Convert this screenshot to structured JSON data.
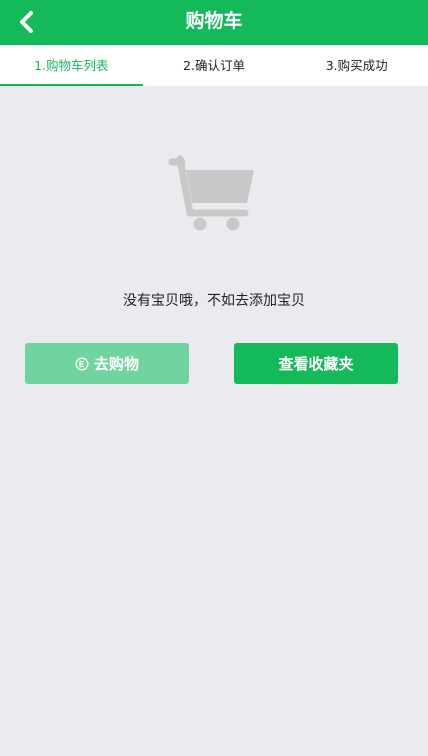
{
  "header": {
    "title": "购物车",
    "back_icon": "chevron-left-icon"
  },
  "tabs": [
    {
      "label": "1.购物车列表",
      "active": true
    },
    {
      "label": "2.确认订单",
      "active": false
    },
    {
      "label": "3.购买成功",
      "active": false
    }
  ],
  "empty_state": {
    "icon": "shopping-cart-icon",
    "message": "没有宝贝哦，不如去添加宝贝"
  },
  "actions": {
    "go_shopping_label": "去购物",
    "go_shopping_icon": "circle-arrow-icon",
    "view_favorites_label": "查看收藏夹"
  },
  "colors": {
    "primary": "#14b95a",
    "primary_light": "#71d3a0",
    "background": "#e9ebee",
    "cart_gray": "#c8c8c8"
  }
}
